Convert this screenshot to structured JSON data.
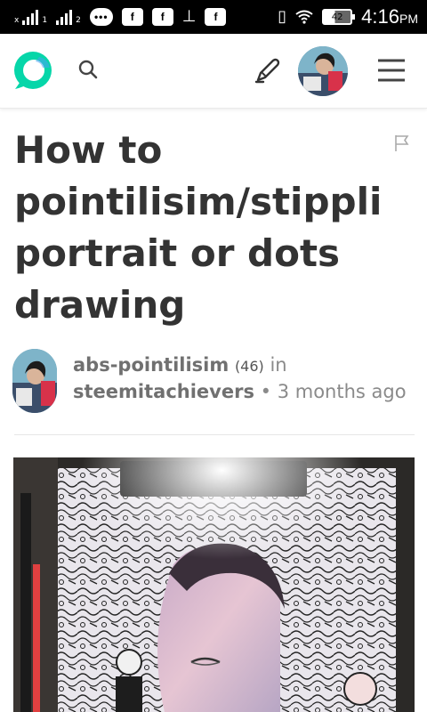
{
  "status_bar": {
    "sim_mark": "x",
    "sim2_mark": "1",
    "sim3_mark": "2",
    "chat_icon_text": "•••",
    "app_icon_1": "f",
    "app_icon_2": "f",
    "app_icon_3": "f",
    "battery_level": "42",
    "time": "4:16",
    "ampm": "PM"
  },
  "header": {
    "icons": [
      "steemit-logo-icon",
      "search-icon",
      "pencil-icon",
      "user-avatar",
      "menu-icon"
    ],
    "brand_color": "#4ba2f2"
  },
  "post": {
    "title": "How to\npointilisim/stippling\nportrait or dots\ndrawing",
    "author": "abs-pointilisim",
    "reputation": "(46)",
    "in_word": " in",
    "community": "steemitachievers",
    "separator": " • ",
    "age": "3 months ago"
  },
  "colors": {
    "title_text": "#333333",
    "meta_text": "#8a8a8a",
    "logo_teal": "#06d6a9"
  }
}
